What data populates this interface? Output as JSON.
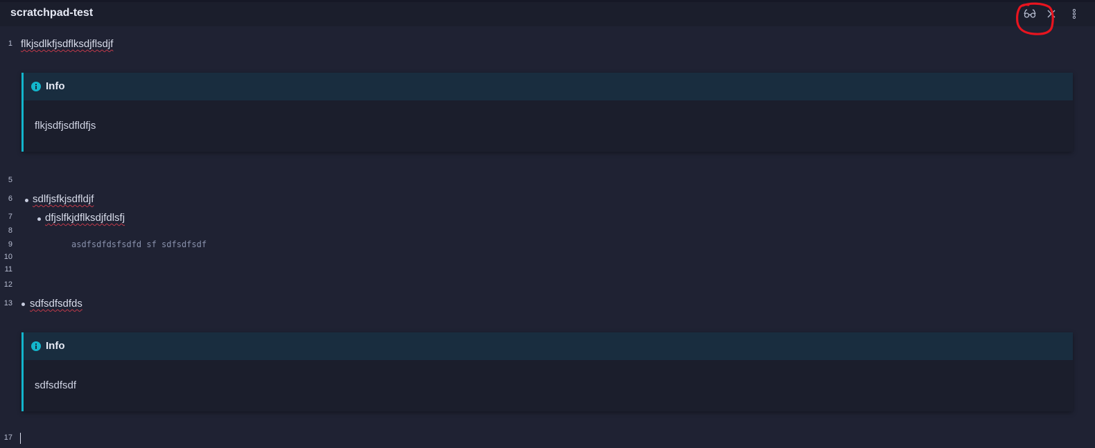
{
  "header": {
    "title": "scratchpad-test",
    "icons": [
      "reading-view-icon",
      "close-icon",
      "more-options-icon"
    ]
  },
  "editor": {
    "line_numbers": [
      "1",
      "5",
      "6",
      "7",
      "8",
      "9",
      "10",
      "11",
      "12",
      "13",
      "17"
    ],
    "line1": "flkjsdlkfjsdflksdjflsdjf",
    "bullet1": "sdlfjsfkjsdfldjf",
    "bullet1_child": "dfjslfkjdflksdjfdlsfj",
    "code_line": "asdfsdfdsfsdfd sf sdfsdfsdf",
    "bullet2": "sdfsdfsdfds",
    "callouts": [
      {
        "title": "Info",
        "body": "flkjsdfjsdfldfjs"
      },
      {
        "title": "Info",
        "body": "sdfsdfsdf"
      }
    ]
  },
  "colors": {
    "background": "#1f2233",
    "header": "#1b1e2c",
    "callout_accent": "#13b6cc",
    "callout_header": "#192d3f",
    "annotation": "#e8141f"
  }
}
